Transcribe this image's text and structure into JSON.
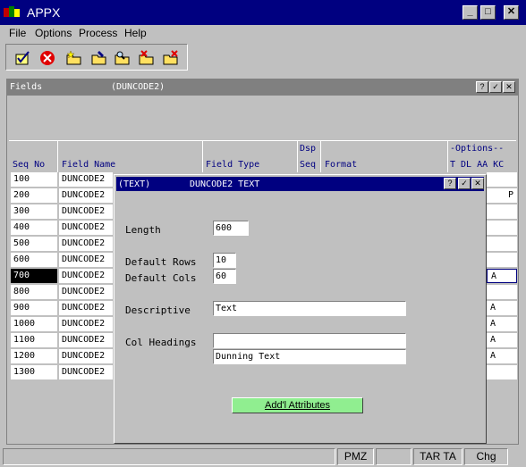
{
  "app": {
    "title": "APPX"
  },
  "menu": [
    "File",
    "Options",
    "Process",
    "Help"
  ],
  "toolbar": {
    "icons": [
      "check-doc-icon",
      "cancel-icon",
      "folder-star-icon",
      "folder-edit-icon",
      "folder-search-icon",
      "folder-delete-icon",
      "folder-cancel-icon"
    ]
  },
  "inner": {
    "title": "Fields",
    "subtitle": "(DUNCODE2)",
    "headers": {
      "seq_no": "Seq No",
      "field_name": "Field Name",
      "field_type": "Field Type",
      "dsp": "Dsp",
      "seq": "Seq",
      "format": "Format",
      "options": "-Options--",
      "opt_cols": "T DL AA KC"
    },
    "rows": [
      {
        "seq": "100",
        "name": "DUNCODE2",
        "opt": ""
      },
      {
        "seq": "200",
        "name": "DUNCODE2",
        "opt": "P"
      },
      {
        "seq": "300",
        "name": "DUNCODE2",
        "opt": ""
      },
      {
        "seq": "400",
        "name": "DUNCODE2",
        "opt": ""
      },
      {
        "seq": "500",
        "name": "DUNCODE2",
        "opt": ""
      },
      {
        "seq": "600",
        "name": "DUNCODE2",
        "opt": ""
      },
      {
        "seq": "700",
        "name": "DUNCODE2",
        "opt": "A"
      },
      {
        "seq": "800",
        "name": "DUNCODE2",
        "opt": ""
      },
      {
        "seq": "900",
        "name": "DUNCODE2",
        "opt": "A"
      },
      {
        "seq": "1000",
        "name": "DUNCODE2",
        "opt": "A"
      },
      {
        "seq": "1100",
        "name": "DUNCODE2",
        "opt": "A"
      },
      {
        "seq": "1200",
        "name": "DUNCODE2",
        "opt": "A"
      },
      {
        "seq": "1300",
        "name": "DUNCODE2",
        "opt": ""
      }
    ]
  },
  "dialog": {
    "title_left": "(TEXT)",
    "title_right": "DUNCODE2 TEXT",
    "labels": {
      "length": "Length",
      "default_rows": "Default Rows",
      "default_cols": "Default Cols",
      "descriptive": "Descriptive",
      "col_headings": "Col Headings"
    },
    "values": {
      "length": "600",
      "default_rows": "10",
      "default_cols": "60",
      "descriptive": "Text",
      "col_heading_1": "",
      "col_heading_2": "Dunning Text"
    },
    "button": "Add'l Attributes"
  },
  "status": [
    "",
    "PMZ",
    "",
    "TAR TA",
    "Chg"
  ]
}
